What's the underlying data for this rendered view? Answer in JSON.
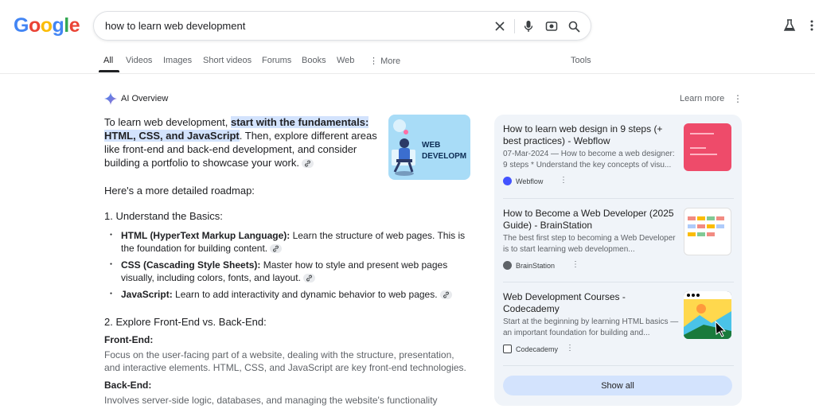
{
  "search": {
    "query": "how to learn web development"
  },
  "tabs": [
    "All",
    "Videos",
    "Images",
    "Short videos",
    "Forums",
    "Books",
    "Web",
    "More",
    "Tools"
  ],
  "ai_overview": {
    "title": "AI Overview",
    "learn_more": "Learn more",
    "intro_pre": "To learn web development, ",
    "intro_highlight": "start with the fundamentals: HTML, CSS, and JavaScript",
    "intro_post": ". Then, explore different areas like front-end and back-end development, and consider building a portfolio to showcase your work.",
    "thumb_text": "WEB DEVELOPM",
    "roadmap_intro": "Here's a more detailed roadmap:",
    "section1_title": "1. Understand the Basics:",
    "basics": [
      {
        "term": "HTML (HyperText Markup Language):",
        "desc": " Learn the structure of web pages. This is the foundation for building content."
      },
      {
        "term": "CSS (Cascading Style Sheets):",
        "desc": " Master how to style and present web pages visually, including colors, fonts, and layout."
      },
      {
        "term": "JavaScript:",
        "desc": " Learn to add interactivity and dynamic behavior to web pages."
      }
    ],
    "section2_title": "2. Explore Front-End vs. Back-End:",
    "frontend_title": "Front-End:",
    "frontend_desc": "Focus on the user-facing part of a website, dealing with the structure, presentation, and interactive elements. HTML, CSS, and JavaScript are key front-end technologies.",
    "backend_title": "Back-End:",
    "backend_desc": "Involves server-side logic, databases, and managing the website's functionality"
  },
  "sources": [
    {
      "title": "How to learn web design in 9 steps (+ best practices) - Webflow",
      "snippet": "07-Mar-2024 — How to become a web designer: 9 steps * Understand the key concepts of visu...",
      "site": "Webflow"
    },
    {
      "title": "How to Become a Web Developer (2025 Guide) - BrainStation",
      "snippet": "The best first step to becoming a Web Developer is to start learning web developmen...",
      "site": "BrainStation"
    },
    {
      "title": "Web Development Courses - Codecademy",
      "snippet": "Start at the beginning by learning HTML basics — an important foundation for building and...",
      "site": "Codecademy"
    }
  ],
  "show_all": "Show all"
}
